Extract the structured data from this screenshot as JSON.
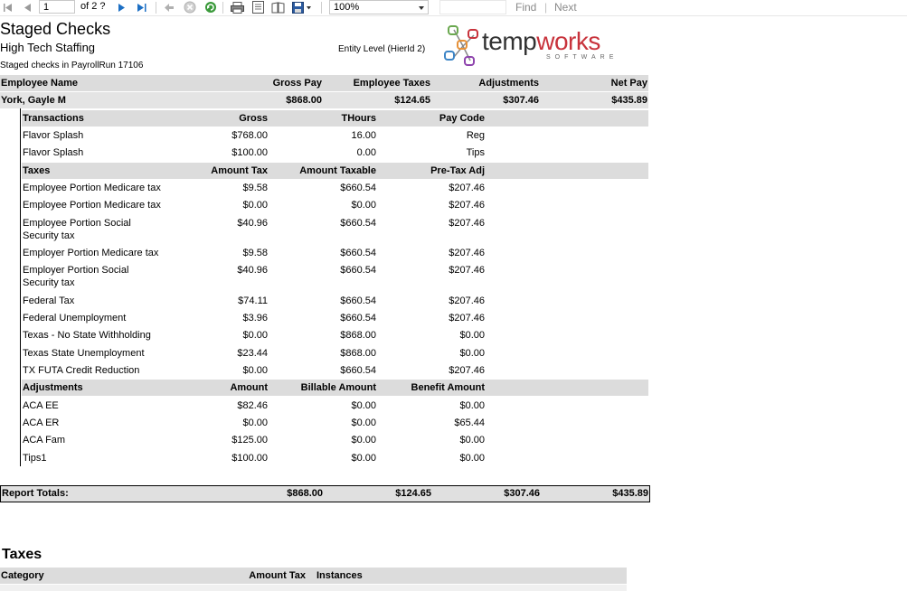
{
  "toolbar": {
    "page_value": "1",
    "of_text": "of  2 ?",
    "zoom": "100%",
    "find_label": "Find",
    "separator": "|",
    "next_label": "Next"
  },
  "report": {
    "title": "Staged Checks",
    "company": "High Tech Staffing",
    "subtitle": "Staged checks in PayrollRun 17106",
    "entity_level": "Entity Level (HierId 2)",
    "logo_text_1": "temp",
    "logo_text_2": "works",
    "logo_sub": "SOFTWARE",
    "summary_headers": [
      "Employee Name",
      "Gross Pay",
      "Employee Taxes",
      "Adjustments",
      "Net Pay"
    ],
    "employee": {
      "name": "York, Gayle M",
      "gross_pay": "$868.00",
      "employee_taxes": "$124.65",
      "adjustments": "$307.46",
      "net_pay": "$435.89"
    },
    "transactions": {
      "headers": [
        "Transactions",
        "Gross",
        "THours",
        "Pay Code"
      ],
      "rows": [
        [
          "Flavor Splash",
          "$768.00",
          "16.00",
          "Reg"
        ],
        [
          "Flavor Splash",
          "$100.00",
          "0.00",
          "Tips"
        ]
      ]
    },
    "taxes": {
      "headers": [
        "Taxes",
        "Amount Tax",
        "Amount Taxable",
        "Pre-Tax Adj"
      ],
      "rows": [
        [
          "Employee Portion  Medicare tax",
          "$9.58",
          "$660.54",
          "$207.46"
        ],
        [
          "Employee Portion  Medicare tax",
          "$0.00",
          "$0.00",
          "$207.46"
        ],
        [
          "Employee Portion Social Security tax",
          "$40.96",
          "$660.54",
          "$207.46"
        ],
        [
          "Employer Portion  Medicare tax",
          "$9.58",
          "$660.54",
          "$207.46"
        ],
        [
          "Employer Portion Social Security tax",
          "$40.96",
          "$660.54",
          "$207.46"
        ],
        [
          "Federal Tax",
          "$74.11",
          "$660.54",
          "$207.46"
        ],
        [
          "Federal Unemployment",
          "$3.96",
          "$660.54",
          "$207.46"
        ],
        [
          "Texas - No State Withholding",
          "$0.00",
          "$868.00",
          "$0.00"
        ],
        [
          "Texas State Unemployment",
          "$23.44",
          "$868.00",
          "$0.00"
        ],
        [
          "TX FUTA Credit Reduction",
          "$0.00",
          "$660.54",
          "$207.46"
        ]
      ]
    },
    "adjustments": {
      "headers": [
        "Adjustments",
        "Amount",
        "Billable Amount",
        "Benefit Amount"
      ],
      "rows": [
        [
          "ACA EE",
          "$82.46",
          "$0.00",
          "$0.00"
        ],
        [
          "ACA ER",
          "$0.00",
          "$0.00",
          "$65.44"
        ],
        [
          "ACA Fam",
          "$125.00",
          "$0.00",
          "$0.00"
        ],
        [
          "Tips1",
          "$100.00",
          "$0.00",
          "$0.00"
        ]
      ]
    },
    "totals": {
      "label": "Report Totals:",
      "gross_pay": "$868.00",
      "employee_taxes": "$124.65",
      "adjustments": "$307.46",
      "net_pay": "$435.89"
    },
    "taxes_section": {
      "title": "Taxes",
      "headers": [
        "Category",
        "Amount Tax",
        "Instances"
      ]
    }
  }
}
